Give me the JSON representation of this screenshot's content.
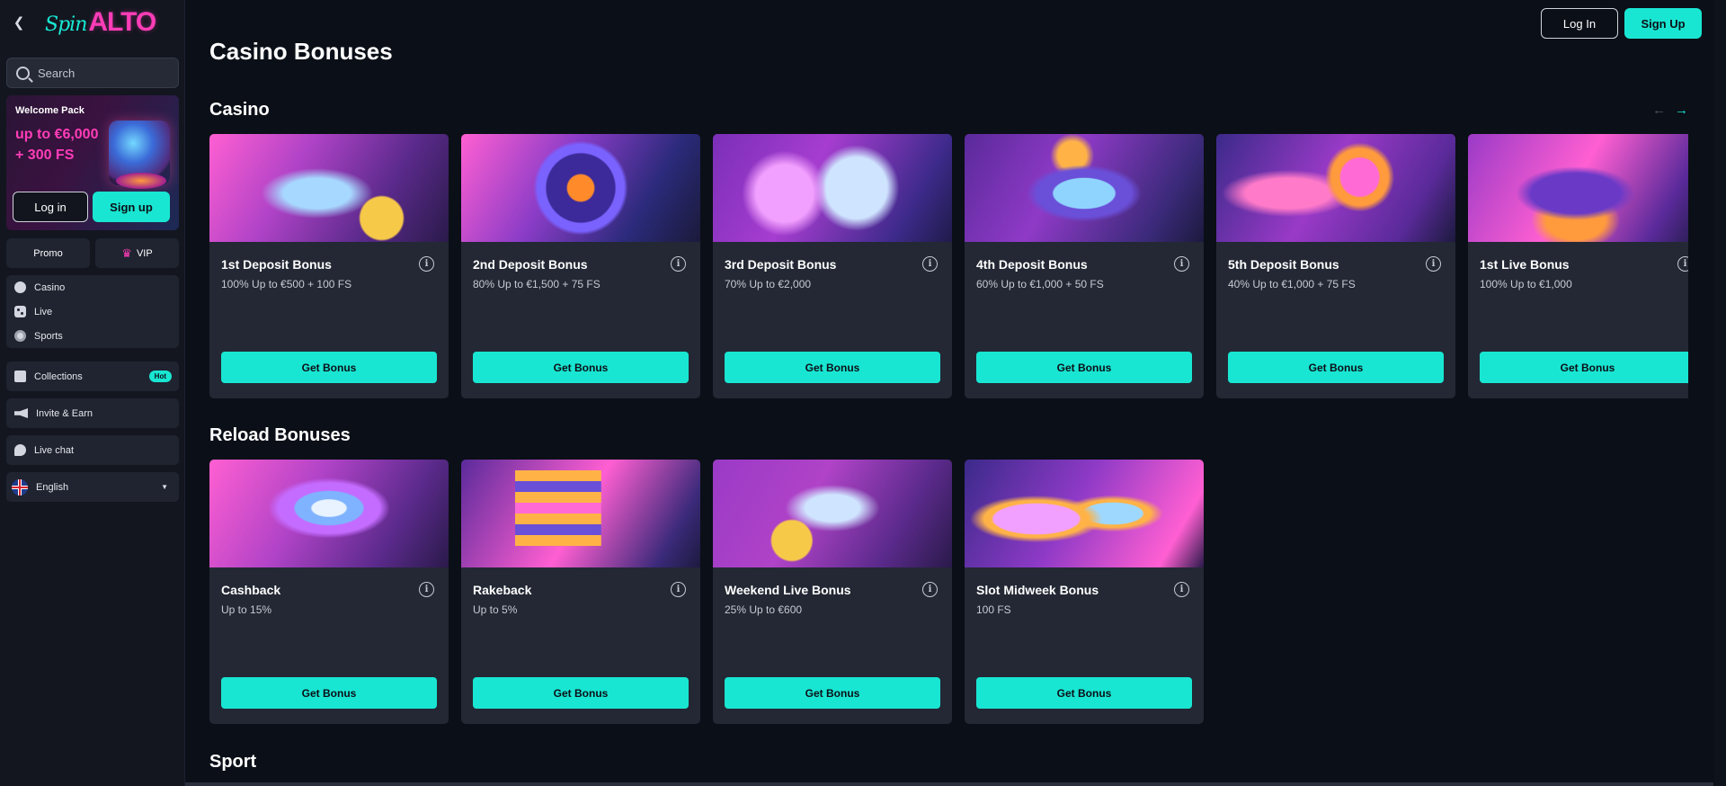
{
  "brand": {
    "logo_script": "Spin",
    "logo_main": "ALTO",
    "accent": "#19e6d2",
    "pink": "#ff3db8"
  },
  "sidebar": {
    "search_placeholder": "Search",
    "welcome": {
      "title": "Welcome Pack",
      "amount_line1": "up to €6,000",
      "amount_line2": "+ 300 FS",
      "login": "Log in",
      "signup": "Sign up"
    },
    "promo": "Promo",
    "vip": "VIP",
    "games": [
      {
        "label": "Casino",
        "icon": "ball-icon"
      },
      {
        "label": "Live",
        "icon": "dice-icon"
      },
      {
        "label": "Sports",
        "icon": "soccer-icon"
      }
    ],
    "collections": {
      "label": "Collections",
      "badge": "Hot"
    },
    "invite": "Invite & Earn",
    "live_chat": "Live chat",
    "language": "English"
  },
  "header": {
    "login": "Log In",
    "signup": "Sign Up"
  },
  "main": {
    "page_title": "Casino Bonuses",
    "sections": {
      "casino": {
        "title": "Casino",
        "cards": [
          {
            "title": "1st Deposit Bonus",
            "desc": "100% Up to €500 + 100 FS",
            "button": "Get Bonus"
          },
          {
            "title": "2nd Deposit Bonus",
            "desc": "80% Up to €1,500 + 75 FS",
            "button": "Get Bonus"
          },
          {
            "title": "3rd Deposit Bonus",
            "desc": "70% Up to €2,000",
            "button": "Get Bonus"
          },
          {
            "title": "4th Deposit Bonus",
            "desc": "60% Up to €1,000 + 50 FS",
            "button": "Get Bonus"
          },
          {
            "title": "5th Deposit Bonus",
            "desc": "40% Up to €1,000 + 75 FS",
            "button": "Get Bonus"
          },
          {
            "title": "1st Live Bonus",
            "desc": "100% Up to €1,000",
            "button": "Get Bonus"
          }
        ]
      },
      "reload": {
        "title": "Reload Bonuses",
        "cards": [
          {
            "title": "Cashback",
            "desc": "Up to 15%",
            "button": "Get Bonus"
          },
          {
            "title": "Rakeback",
            "desc": "Up to 5%",
            "button": "Get Bonus"
          },
          {
            "title": "Weekend Live Bonus",
            "desc": "25% Up to €600",
            "button": "Get Bonus"
          },
          {
            "title": "Slot Midweek Bonus",
            "desc": "100 FS",
            "button": "Get Bonus"
          }
        ]
      },
      "sport": {
        "title": "Sport"
      }
    }
  }
}
